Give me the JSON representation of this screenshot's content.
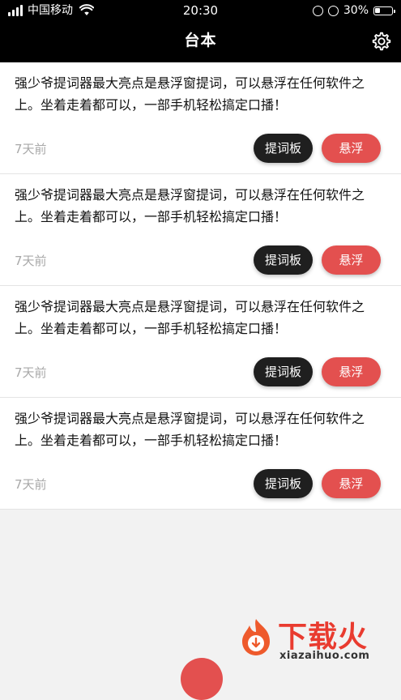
{
  "status_bar": {
    "carrier": "中国移动",
    "time": "20:30",
    "battery": "30%",
    "battery_level": 0.3
  },
  "header": {
    "title": "台本",
    "settings_icon": "gear-icon"
  },
  "scripts": [
    {
      "text": "强少爷提词器最大亮点是悬浮窗提词，可以悬浮在任何软件之上。坐着走着都可以，一部手机轻松搞定口播！",
      "time": "7天前",
      "board_label": "提词板",
      "float_label": "悬浮"
    },
    {
      "text": "强少爷提词器最大亮点是悬浮窗提词，可以悬浮在任何软件之上。坐着走着都可以，一部手机轻松搞定口播！",
      "time": "7天前",
      "board_label": "提词板",
      "float_label": "悬浮"
    },
    {
      "text": "强少爷提词器最大亮点是悬浮窗提词，可以悬浮在任何软件之上。坐着走着都可以，一部手机轻松搞定口播！",
      "time": "7天前",
      "board_label": "提词板",
      "float_label": "悬浮"
    },
    {
      "text": "强少爷提词器最大亮点是悬浮窗提词，可以悬浮在任何软件之上。坐着走着都可以，一部手机轻松搞定口播！",
      "time": "7天前",
      "board_label": "提词板",
      "float_label": "悬浮"
    }
  ],
  "watermark": {
    "brand": "下载火",
    "url": "xiazaihuo.com"
  },
  "colors": {
    "float_button": "#e3504f",
    "board_button": "#1f1f1f",
    "header_bg": "#000000"
  }
}
